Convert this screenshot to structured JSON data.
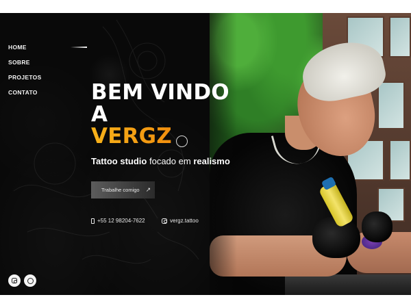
{
  "nav": {
    "items": [
      {
        "label": "HOME",
        "active": true
      },
      {
        "label": "SOBRE",
        "active": false
      },
      {
        "label": "PROJETOS",
        "active": false
      },
      {
        "label": "CONTATO",
        "active": false
      }
    ]
  },
  "hero": {
    "line1": "BEM VINDO",
    "line2": "A",
    "brand": "VERGZ",
    "brand_colors": [
      "#f7b21a",
      "#f18f0e"
    ],
    "subtitle_part1": "Tattoo studio",
    "subtitle_part2": "focado em",
    "subtitle_part3": "realismo",
    "cta_label": "Trabalhe comigo",
    "cta_icon": "arrow-up-right-icon"
  },
  "contact": {
    "phone": "+55 12 98204-7622",
    "phone_icon": "phone-icon",
    "instagram": "vergz.tattoo",
    "instagram_icon": "instagram-icon"
  },
  "social": {
    "icons": [
      "instagram-icon",
      "whatsapp-icon"
    ]
  },
  "colors": {
    "background": "#0b0b0b",
    "text": "#ffffff",
    "accent": "#f7b21a"
  }
}
